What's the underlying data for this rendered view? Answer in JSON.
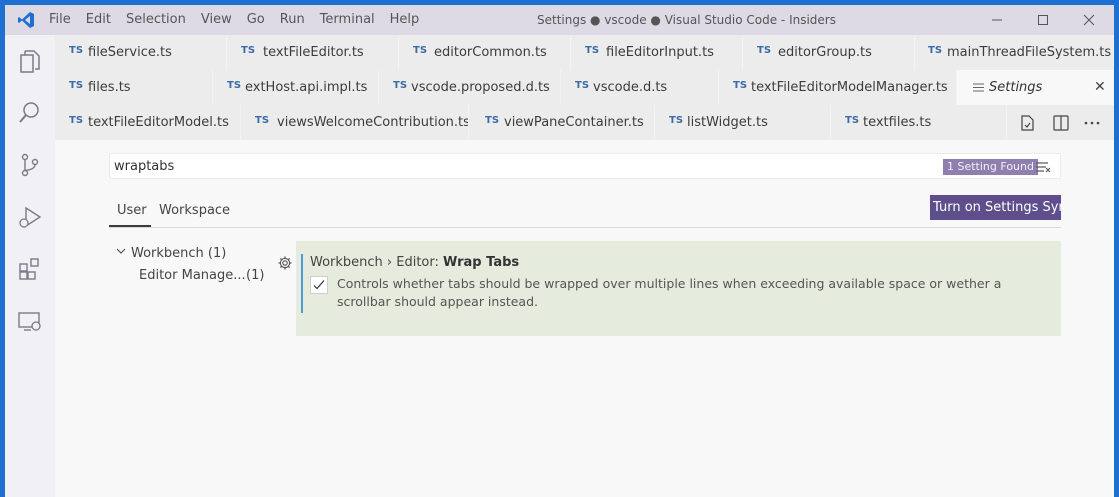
{
  "titlebar": {
    "menu": [
      "File",
      "Edit",
      "Selection",
      "View",
      "Go",
      "Run",
      "Terminal",
      "Help"
    ],
    "title": "Settings ● vscode ● Visual Studio Code - Insiders"
  },
  "tabs": {
    "lang_badge": "TS",
    "row1": [
      "fileService.ts",
      "textFileEditor.ts",
      "editorCommon.ts",
      "fileEditorInput.ts",
      "editorGroup.ts",
      "mainThreadFileSystem.ts"
    ],
    "row2": [
      "files.ts",
      "extHost.api.impl.ts",
      "vscode.proposed.d.ts",
      "vscode.d.ts",
      "textFileEditorModelManager.ts"
    ],
    "row3": [
      "textFileEditorModel.ts",
      "viewsWelcomeContribution.ts",
      "viewPaneContainer.ts",
      "listWidget.ts",
      "textfiles.ts"
    ],
    "active_tab": "Settings"
  },
  "settings": {
    "search_value": "wraptabs",
    "result_count": "1 Setting Found",
    "scope_user": "User",
    "scope_workspace": "Workspace",
    "sync_button": "Turn on Settings Sync",
    "toc": {
      "workbench": "Workbench (1)",
      "editor_management": "Editor Manage...",
      "editor_management_count": "(1)"
    },
    "setting": {
      "category": "Workbench › Editor: ",
      "name": "Wrap Tabs",
      "description": "Controls whether tabs should be wrapped over multiple lines when exceeding available space or wether a scrollbar should appear instead.",
      "checked": true
    }
  },
  "colors": {
    "accent_purple": "#5e4f8c",
    "badge_purple": "#8f7fae",
    "modified_setting_bg": "#e5ebdd",
    "modified_indicator": "#4a9dd8",
    "desktop_blue": "#1f6fd1"
  }
}
